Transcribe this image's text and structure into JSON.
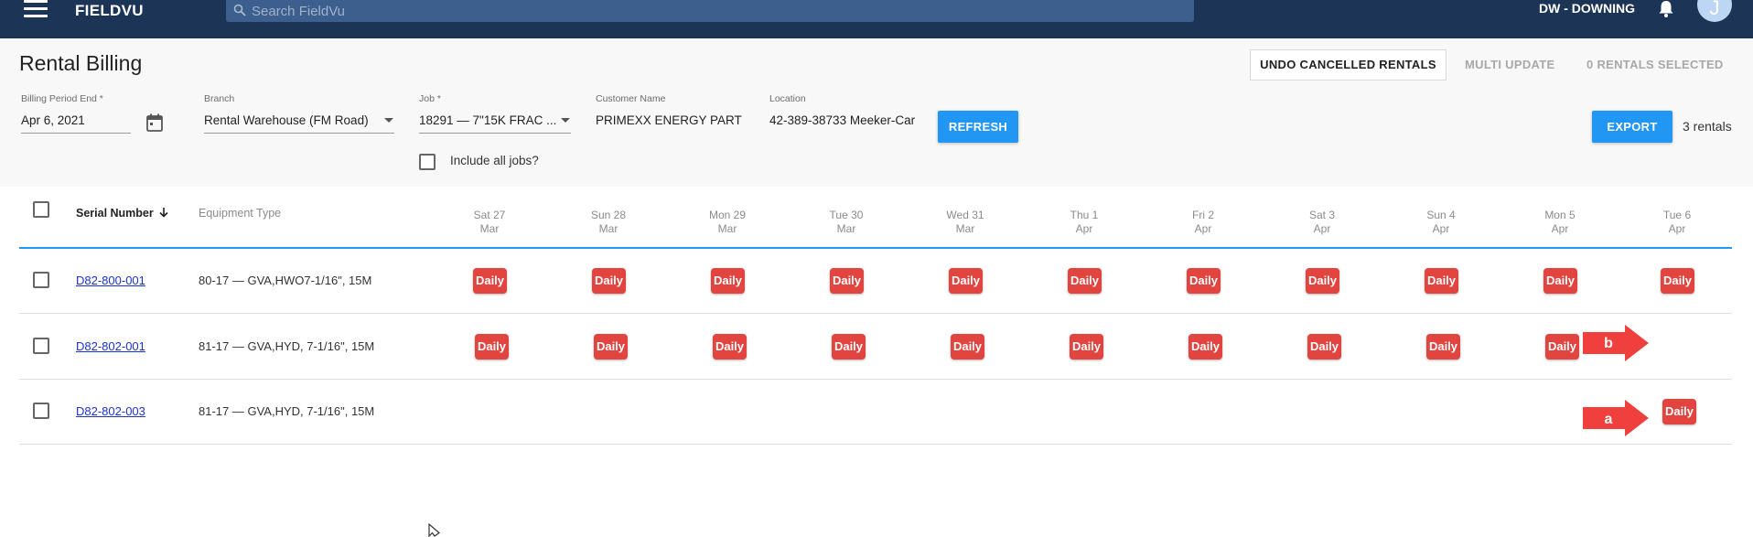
{
  "topbar": {
    "brand": "FIELDVU",
    "search_placeholder": "Search FieldVu",
    "user_label": "DW - DOWNING",
    "avatar_initial": "J"
  },
  "page": {
    "title": "Rental Billing",
    "undo_label": "UNDO CANCELLED RENTALS",
    "multi_update_label": "MULTI UPDATE",
    "selected_label": "0 RENTALS SELECTED"
  },
  "filters": {
    "billing_period_label": "Billing Period End *",
    "billing_period_value": "Apr 6, 2021",
    "branch_label": "Branch",
    "branch_value": "Rental Warehouse (FM Road)",
    "job_label": "Job *",
    "job_value": "18291 — 7\"15K FRAC ...",
    "customer_label": "Customer Name",
    "customer_value": "PRIMEXX ENERGY PARTN",
    "location_label": "Location",
    "location_value": "42-389-38733 Meeker-Car",
    "refresh_label": "REFRESH",
    "include_all_label": "Include all jobs?",
    "export_label": "EXPORT",
    "rental_count": "3 rentals"
  },
  "table": {
    "serial_header": "Serial Number",
    "type_header": "Equipment Type",
    "days": [
      {
        "dow": "Sat 27",
        "mon": "Mar"
      },
      {
        "dow": "Sun 28",
        "mon": "Mar"
      },
      {
        "dow": "Mon 29",
        "mon": "Mar"
      },
      {
        "dow": "Tue 30",
        "mon": "Mar"
      },
      {
        "dow": "Wed 31",
        "mon": "Mar"
      },
      {
        "dow": "Thu 1",
        "mon": "Apr"
      },
      {
        "dow": "Fri 2",
        "mon": "Apr"
      },
      {
        "dow": "Sat 3",
        "mon": "Apr"
      },
      {
        "dow": "Sun 4",
        "mon": "Apr"
      },
      {
        "dow": "Mon 5",
        "mon": "Apr"
      },
      {
        "dow": "Tue 6",
        "mon": "Apr"
      }
    ],
    "badge_label": "Daily",
    "rows": [
      {
        "serial": "D82-800-001",
        "type": "80-17 — GVA,HWO7-1/16\", 15M",
        "daily_days": [
          0,
          1,
          2,
          3,
          4,
          5,
          6,
          7,
          8,
          9,
          10
        ]
      },
      {
        "serial": "D82-802-001",
        "type": "81-17 — GVA,HYD, 7-1/16\", 15M",
        "daily_days": [
          0,
          1,
          2,
          3,
          4,
          5,
          6,
          7,
          8,
          9
        ]
      },
      {
        "serial": "D82-802-003",
        "type": "81-17 — GVA,HYD, 7-1/16\", 15M",
        "daily_days": [
          10
        ]
      }
    ]
  },
  "annotations": {
    "arrow_b": "b",
    "arrow_a": "a",
    "arrow_color": "#f0403d"
  },
  "colors": {
    "topbar": "#1c3557",
    "accent": "#2196f3",
    "badge": "#e2443f",
    "link": "#1a33cc"
  },
  "icons": [
    "menu-icon",
    "search-icon",
    "bell-icon",
    "calendar-icon",
    "sort-arrow-down-icon",
    "dropdown-caret-icon",
    "mouse-pointer-icon"
  ]
}
